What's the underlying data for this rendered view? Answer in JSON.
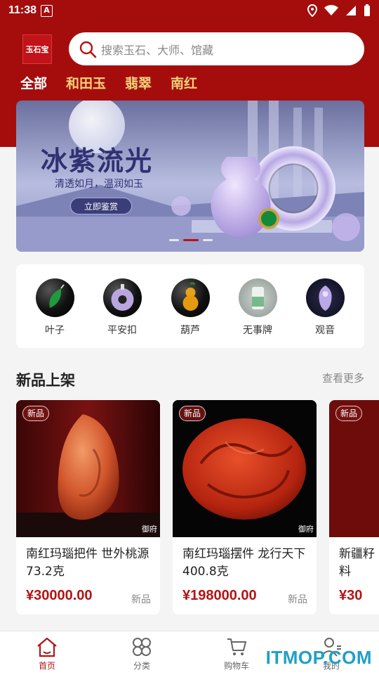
{
  "statusbar": {
    "time": "11:38",
    "app_badge": "A"
  },
  "header": {
    "logo_text": "玉石宝",
    "search_placeholder": "搜索玉石、大师、馆藏",
    "tabs": [
      {
        "label": "全部",
        "active": true
      },
      {
        "label": "和田玉",
        "active": false
      },
      {
        "label": "翡翠",
        "active": false
      },
      {
        "label": "南红",
        "active": false
      }
    ]
  },
  "banner": {
    "title": "冰紫流光",
    "subtitle": "清透如月，温润如玉",
    "button_label": "立即鉴赏",
    "dots_total": 3,
    "active_dot": 1
  },
  "quick_categories": [
    {
      "label": "叶子",
      "icon": "leaf-pendant-icon"
    },
    {
      "label": "平安扣",
      "icon": "safety-buckle-icon"
    },
    {
      "label": "葫芦",
      "icon": "gourd-icon"
    },
    {
      "label": "无事牌",
      "icon": "plaque-icon"
    },
    {
      "label": "观音",
      "icon": "guanyin-icon"
    }
  ],
  "section": {
    "title": "新品上架",
    "more_label": "查看更多"
  },
  "products": [
    {
      "badge": "新品",
      "name": "南红玛瑙把件 世外桃源 73.2克",
      "price": "¥30000.00",
      "tag": "新品",
      "watermark": "御府"
    },
    {
      "badge": "新品",
      "name": "南红玛瑙摆件 龙行天下 400.8克",
      "price": "¥198000.00",
      "tag": "新品",
      "watermark": "御府"
    },
    {
      "badge": "新品",
      "name": "新疆籽料",
      "price": "¥30",
      "tag": "",
      "watermark": ""
    }
  ],
  "bottom_nav": [
    {
      "label": "首页",
      "icon": "home-icon",
      "active": true
    },
    {
      "label": "分类",
      "icon": "category-icon",
      "active": false
    },
    {
      "label": "购物车",
      "icon": "cart-icon",
      "active": false
    },
    {
      "label": "我的",
      "icon": "user-icon",
      "active": false
    }
  ],
  "site_watermark": "ITMOP.COM",
  "colors": {
    "brand_red": "#a50d0d",
    "price_red": "#b31414",
    "gold_tab": "#f3d27a"
  }
}
